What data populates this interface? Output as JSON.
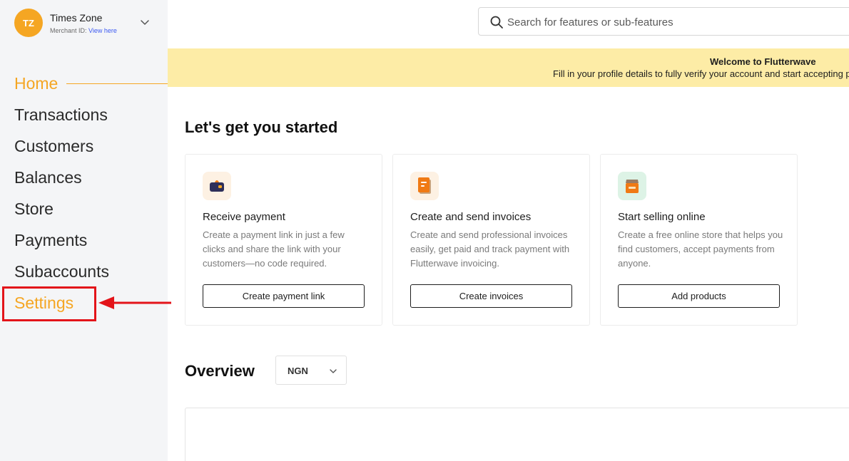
{
  "merchant": {
    "initials": "TZ",
    "name": "Times Zone",
    "id_label": "Merchant ID:",
    "id_link": "View here"
  },
  "nav": {
    "items": [
      {
        "label": "Home"
      },
      {
        "label": "Transactions"
      },
      {
        "label": "Customers"
      },
      {
        "label": "Balances"
      },
      {
        "label": "Store"
      },
      {
        "label": "Payments"
      },
      {
        "label": "Subaccounts"
      },
      {
        "label": "Settings"
      }
    ],
    "active": "Home",
    "highlighted": "Settings"
  },
  "search": {
    "placeholder": "Search for features or sub-features"
  },
  "banner": {
    "title": "Welcome to Flutterwave",
    "subtitle": "Fill in your profile details to fully verify your account and start accepting payments."
  },
  "get_started": {
    "title": "Let's get you started",
    "cards": [
      {
        "title": "Receive payment",
        "description": "Create a payment link in just a few clicks and share the link with your customers—no code required.",
        "button": "Create payment link",
        "icon": "wallet-icon"
      },
      {
        "title": "Create and send invoices",
        "description": "Create and send professional invoices easily, get paid and track payment with Flutterwave invoicing.",
        "button": "Create invoices",
        "icon": "invoice-icon"
      },
      {
        "title": "Start selling online",
        "description": "Create a free online store that helps you find customers, accept payments from anyone.",
        "button": "Add products",
        "icon": "store-icon"
      }
    ]
  },
  "overview": {
    "title": "Overview",
    "currency": "NGN"
  },
  "colors": {
    "accent": "#f5a623",
    "banner": "#fdeca6",
    "annotation_red": "#e3141a",
    "sidebar_bg": "#f4f5f7"
  }
}
